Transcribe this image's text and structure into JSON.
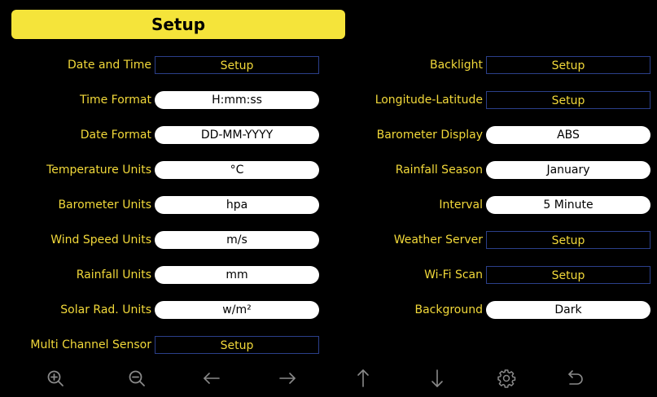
{
  "header": {
    "title": "Setup"
  },
  "left": [
    {
      "label": "Date and Time",
      "value": "Setup"
    },
    {
      "label": "Time Format",
      "value": "H:mm:ss"
    },
    {
      "label": "Date Format",
      "value": "DD-MM-YYYY"
    },
    {
      "label": "Temperature Units",
      "value": "°C"
    },
    {
      "label": "Barometer Units",
      "value": "hpa"
    },
    {
      "label": "Wind Speed Units",
      "value": "m/s"
    },
    {
      "label": "Rainfall Units",
      "value": "mm"
    },
    {
      "label": "Solar Rad. Units",
      "value": "w/m²"
    },
    {
      "label": "Multi Channel Sensor",
      "value": "Setup"
    }
  ],
  "right": [
    {
      "label": "Backlight",
      "value": "Setup"
    },
    {
      "label": "Longitude-Latitude",
      "value": "Setup"
    },
    {
      "label": "Barometer Display",
      "value": "ABS"
    },
    {
      "label": "Rainfall Season",
      "value": "January"
    },
    {
      "label": "Interval",
      "value": "5 Minute"
    },
    {
      "label": "Weather Server",
      "value": "Setup"
    },
    {
      "label": "Wi-Fi Scan",
      "value": "Setup"
    },
    {
      "label": "Background",
      "value": "Dark"
    }
  ],
  "toolbar": {
    "icons": [
      "zoom-in-icon",
      "zoom-out-icon",
      "arrow-left-icon",
      "arrow-right-icon",
      "arrow-up-icon",
      "arrow-down-icon",
      "gear-icon",
      "back-icon"
    ]
  },
  "colors": {
    "accent": "#f5e43a",
    "label": "#f2d93a",
    "box_border": "#2b3f8a",
    "background": "#000000"
  }
}
